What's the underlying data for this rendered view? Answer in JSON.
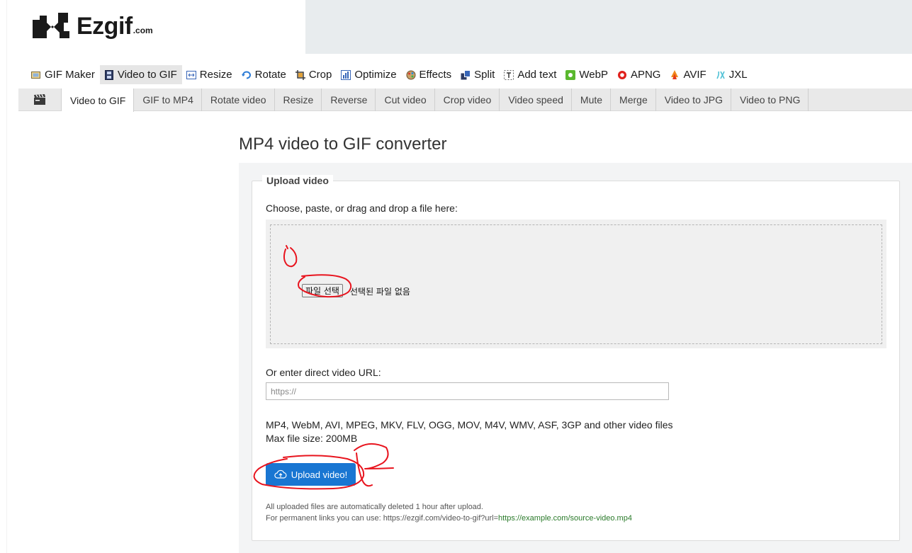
{
  "header": {
    "logo_text": "Ezgif",
    "logo_suffix": ".com"
  },
  "main_nav": [
    {
      "label": "GIF Maker",
      "icon": "gif-maker-icon",
      "active": false
    },
    {
      "label": "Video to GIF",
      "icon": "film-icon",
      "active": true
    },
    {
      "label": "Resize",
      "icon": "resize-icon",
      "active": false
    },
    {
      "label": "Rotate",
      "icon": "rotate-icon",
      "active": false
    },
    {
      "label": "Crop",
      "icon": "crop-icon",
      "active": false
    },
    {
      "label": "Optimize",
      "icon": "optimize-icon",
      "active": false
    },
    {
      "label": "Effects",
      "icon": "effects-icon",
      "active": false
    },
    {
      "label": "Split",
      "icon": "split-icon",
      "active": false
    },
    {
      "label": "Add text",
      "icon": "add-text-icon",
      "active": false
    },
    {
      "label": "WebP",
      "icon": "webp-icon",
      "active": false
    },
    {
      "label": "APNG",
      "icon": "apng-icon",
      "active": false
    },
    {
      "label": "AVIF",
      "icon": "avif-icon",
      "active": false
    },
    {
      "label": "JXL",
      "icon": "jxl-icon",
      "active": false
    }
  ],
  "sub_nav": [
    {
      "label": "Video to GIF",
      "active": true
    },
    {
      "label": "GIF to MP4",
      "active": false
    },
    {
      "label": "Rotate video",
      "active": false
    },
    {
      "label": "Resize",
      "active": false
    },
    {
      "label": "Reverse",
      "active": false
    },
    {
      "label": "Cut video",
      "active": false
    },
    {
      "label": "Crop video",
      "active": false
    },
    {
      "label": "Video speed",
      "active": false
    },
    {
      "label": "Mute",
      "active": false
    },
    {
      "label": "Merge",
      "active": false
    },
    {
      "label": "Video to JPG",
      "active": false
    },
    {
      "label": "Video to PNG",
      "active": false
    }
  ],
  "page_title": "MP4 video to GIF converter",
  "upload": {
    "legend": "Upload video",
    "choose_label": "Choose, paste, or drag and drop a file here:",
    "file_button": "파일 선택",
    "file_status": "선택된 파일 없음",
    "url_label": "Or enter direct video URL:",
    "url_placeholder": "https://",
    "formats": "MP4, WebM, AVI, MPEG, MKV, FLV, OGG, MOV, M4V, WMV, ASF, 3GP and other video files",
    "max_size": "Max file size: 200MB",
    "submit": "Upload video!",
    "note1": "All uploaded files are automatically deleted 1 hour after upload.",
    "note2_prefix": "For permanent links you can use: https://ezgif.com/video-to-gif?url=",
    "note2_link": "https://example.com/source-video.mp4"
  },
  "colors": {
    "accent_blue": "#1976d2",
    "annotation_red": "#e8141e",
    "link_green": "#2a7a2a"
  }
}
